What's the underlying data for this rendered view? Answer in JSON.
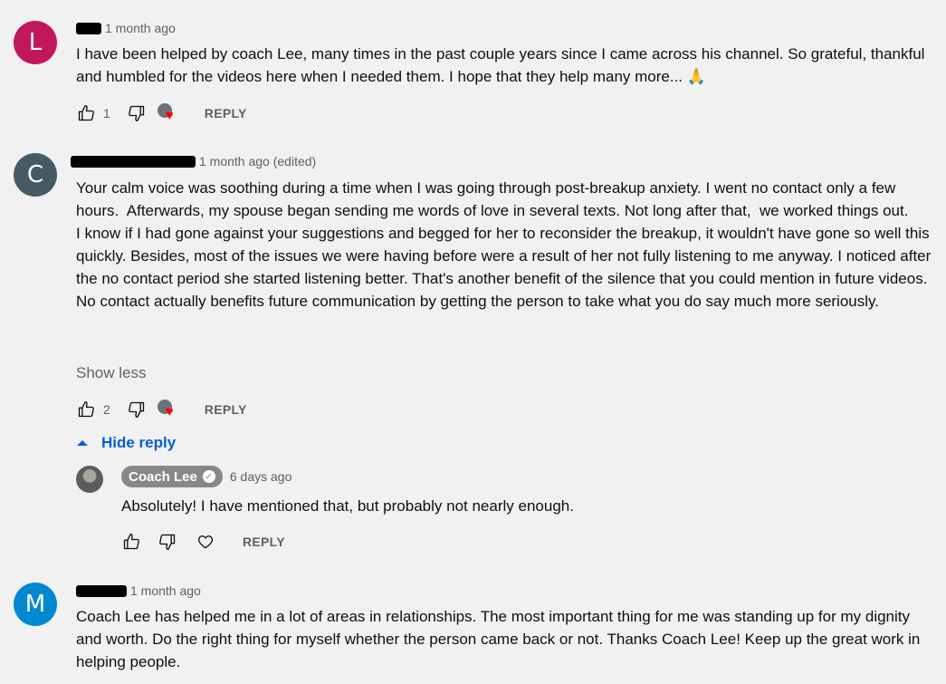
{
  "comments": [
    {
      "avatar_letter": "L",
      "avatar_color": "#c2185b",
      "time": "1 month ago",
      "text": "I have been helped by coach Lee, many times in the past couple years since I came across his channel. So grateful, thankful and humbled for the videos here when I needed them. I hope that they help many more... 🙏",
      "likes": "1",
      "reply_label": "REPLY"
    },
    {
      "avatar_letter": "C",
      "avatar_color": "#455a64",
      "time": "1 month ago (edited)",
      "text": "Your calm voice was soothing during a time when I was going through post-breakup anxiety. I went no contact only a few hours.  Afterwards, my spouse began sending me words of love in several texts. Not long after that,  we worked things out.\nI know if I had gone against your suggestions and begged for her to reconsider the breakup, it wouldn't have gone so well this quickly. Besides, most of the issues we were having before were a result of her not fully listening to me anyway. I noticed after the no contact period she started listening better. That's another benefit of the silence that you could mention in future videos. No contact actually benefits future communication by getting the person to take what you do say much more seriously.",
      "show_less": "Show less",
      "likes": "2",
      "reply_label": "REPLY",
      "hide_reply": "Hide reply",
      "reply": {
        "author": "Coach Lee",
        "time": "6 days ago",
        "text": "Absolutely! I have mentioned that, but probably not nearly enough.",
        "reply_label": "REPLY"
      }
    },
    {
      "avatar_letter": "M",
      "avatar_color": "#0288d1",
      "time": "1 month ago",
      "text": "Coach Lee has helped me in a lot of areas in relationships. The most important thing for me was standing up for my dignity and worth. Do the right thing for myself whether the person came back or not. Thanks Coach Lee! Keep up the great work in helping people."
    }
  ],
  "icons": {
    "like": "thumbs-up-icon",
    "dislike": "thumbs-down-icon",
    "creator_heart": "creator-heart-icon",
    "heart": "heart-outline-icon",
    "verified": "verified-check-icon",
    "collapse": "triangle-up-icon"
  }
}
